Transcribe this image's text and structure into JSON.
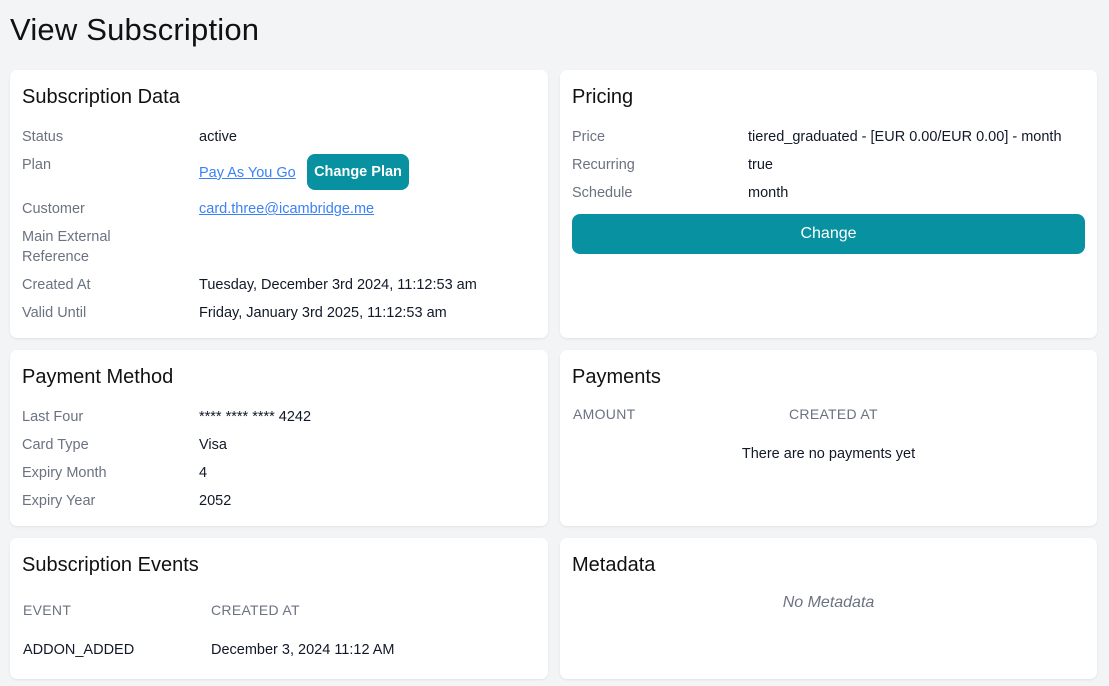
{
  "page": {
    "title": "View Subscription"
  },
  "subscription": {
    "title": "Subscription Data",
    "status_label": "Status",
    "status": "active",
    "plan_label": "Plan",
    "plan": "Pay As You Go",
    "change_plan_label": "Change Plan",
    "customer_label": "Customer",
    "customer": "card.three@icambridge.me",
    "external_ref_label_1": "Main External",
    "external_ref_label_2": "Reference",
    "created_label": "Created At",
    "created": "Tuesday, December 3rd 2024, 11:12:53 am",
    "valid_label": "Valid Until",
    "valid": "Friday, January 3rd 2025, 11:12:53 am"
  },
  "pricing": {
    "title": "Pricing",
    "price_label": "Price",
    "price": "tiered_graduated - [EUR 0.00/EUR 0.00] - month",
    "recurring_label": "Recurring",
    "recurring": "true",
    "schedule_label": "Schedule",
    "schedule": "month",
    "change_label": "Change"
  },
  "payment_method": {
    "title": "Payment Method",
    "last_four_label": "Last Four",
    "last_four": "**** **** **** 4242",
    "card_type_label": "Card Type",
    "card_type": "Visa",
    "expiry_month_label": "Expiry Month",
    "expiry_month": "4",
    "expiry_year_label": "Expiry Year",
    "expiry_year": "2052"
  },
  "payments": {
    "title": "Payments",
    "col_amount": "AMOUNT",
    "col_created": "CREATED AT",
    "empty": "There are no payments yet"
  },
  "events": {
    "title": "Subscription Events",
    "col_event": "EVENT",
    "col_created": "CREATED AT",
    "rows": [
      {
        "event": "ADDON_ADDED",
        "created": "December 3, 2024 11:12 AM"
      }
    ]
  },
  "metadata": {
    "title": "Metadata",
    "empty": "No Metadata"
  }
}
